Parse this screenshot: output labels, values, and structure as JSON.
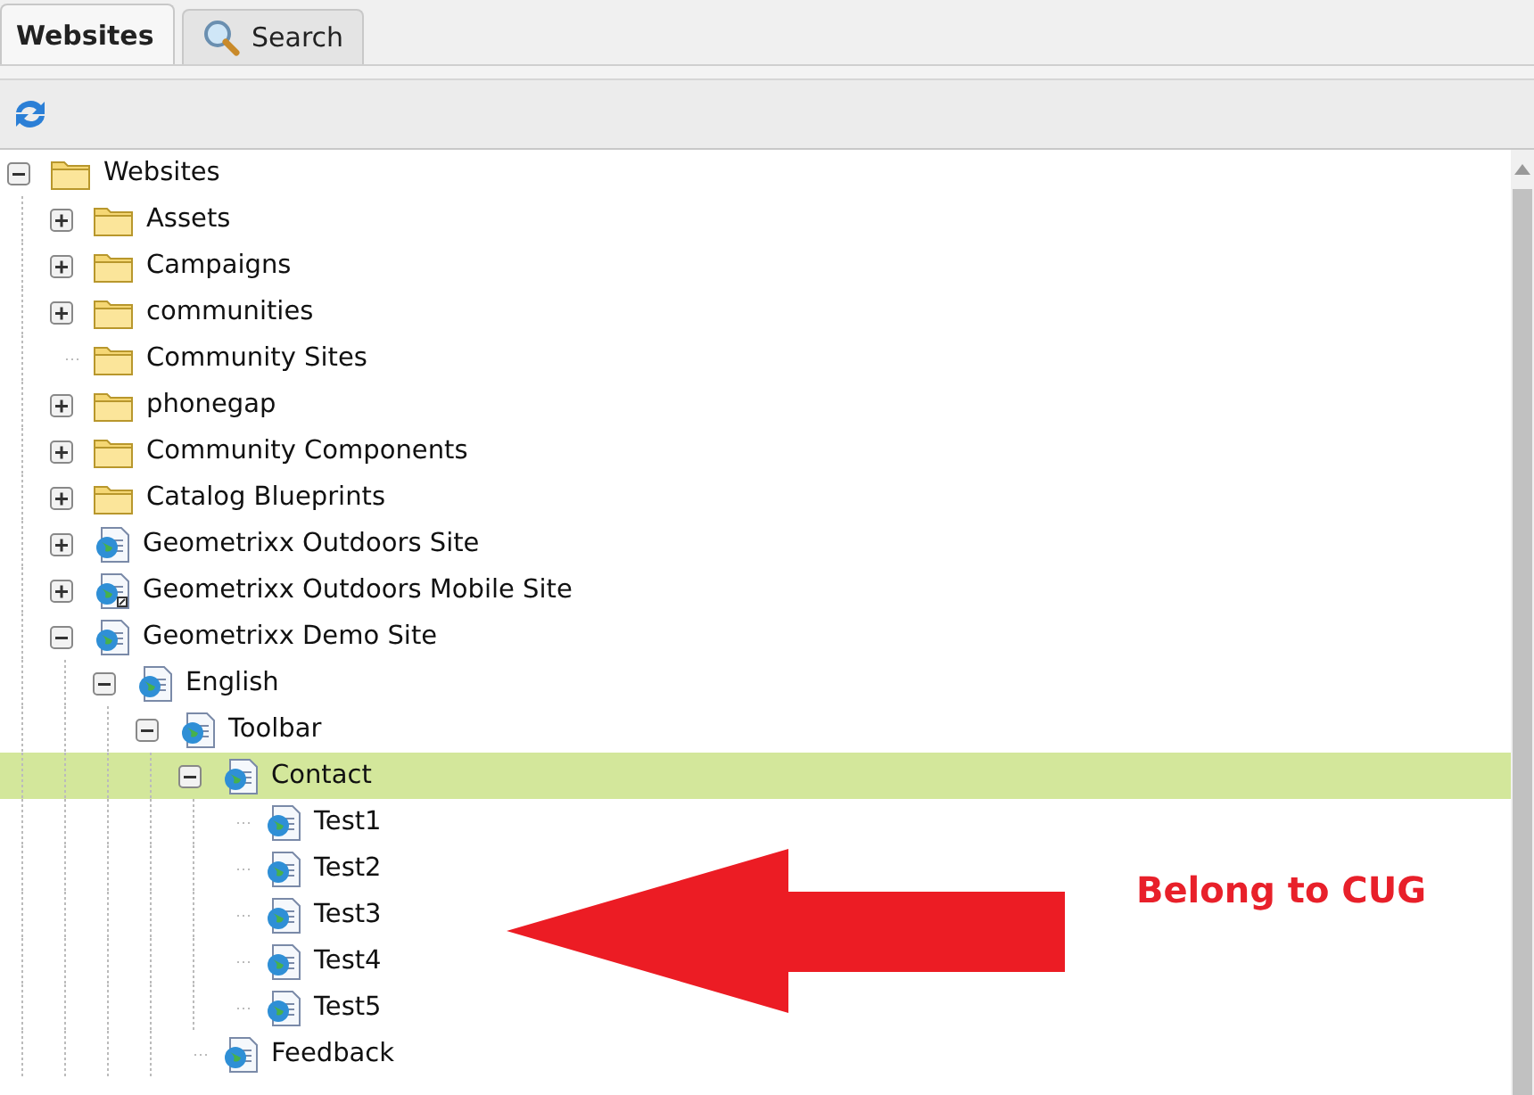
{
  "tabs": [
    {
      "label": "Websites",
      "selected": true
    },
    {
      "label": "Search",
      "selected": false
    }
  ],
  "tree": [
    {
      "label": "Websites",
      "kind": "folder",
      "has_children": true,
      "expanded": true,
      "selected": false,
      "children": [
        {
          "label": "Assets",
          "kind": "folder",
          "has_children": true,
          "expanded": false,
          "selected": false
        },
        {
          "label": "Campaigns",
          "kind": "folder",
          "has_children": true,
          "expanded": false,
          "selected": false
        },
        {
          "label": "communities",
          "kind": "folder",
          "has_children": true,
          "expanded": false,
          "selected": false
        },
        {
          "label": "Community Sites",
          "kind": "folder",
          "has_children": false,
          "selected": false
        },
        {
          "label": "phonegap",
          "kind": "folder",
          "has_children": true,
          "expanded": false,
          "selected": false
        },
        {
          "label": "Community Components",
          "kind": "folder",
          "has_children": true,
          "expanded": false,
          "selected": false
        },
        {
          "label": "Catalog Blueprints",
          "kind": "folder",
          "has_children": true,
          "expanded": false,
          "selected": false
        },
        {
          "label": "Geometrixx Outdoors Site",
          "kind": "page",
          "has_children": true,
          "expanded": false,
          "selected": false
        },
        {
          "label": "Geometrixx Outdoors Mobile Site",
          "kind": "page-link",
          "has_children": true,
          "expanded": false,
          "selected": false
        },
        {
          "label": "Geometrixx Demo Site",
          "kind": "page",
          "has_children": true,
          "expanded": true,
          "selected": false,
          "children": [
            {
              "label": "English",
              "kind": "page",
              "has_children": true,
              "expanded": true,
              "selected": false,
              "children": [
                {
                  "label": "Toolbar",
                  "kind": "page",
                  "has_children": true,
                  "expanded": true,
                  "selected": false,
                  "children": [
                    {
                      "label": "Contact",
                      "kind": "page",
                      "has_children": true,
                      "expanded": true,
                      "selected": true,
                      "children": [
                        {
                          "label": "Test1",
                          "kind": "page",
                          "has_children": false,
                          "selected": false
                        },
                        {
                          "label": "Test2",
                          "kind": "page",
                          "has_children": false,
                          "selected": false
                        },
                        {
                          "label": "Test3",
                          "kind": "page",
                          "has_children": false,
                          "selected": false
                        },
                        {
                          "label": "Test4",
                          "kind": "page",
                          "has_children": false,
                          "selected": false
                        },
                        {
                          "label": "Test5",
                          "kind": "page",
                          "has_children": false,
                          "selected": false
                        }
                      ]
                    },
                    {
                      "label": "Feedback",
                      "kind": "page",
                      "has_children": false,
                      "selected": false
                    }
                  ]
                }
              ]
            }
          ]
        }
      ]
    }
  ],
  "annotation": {
    "text": "Belong to CUG"
  }
}
